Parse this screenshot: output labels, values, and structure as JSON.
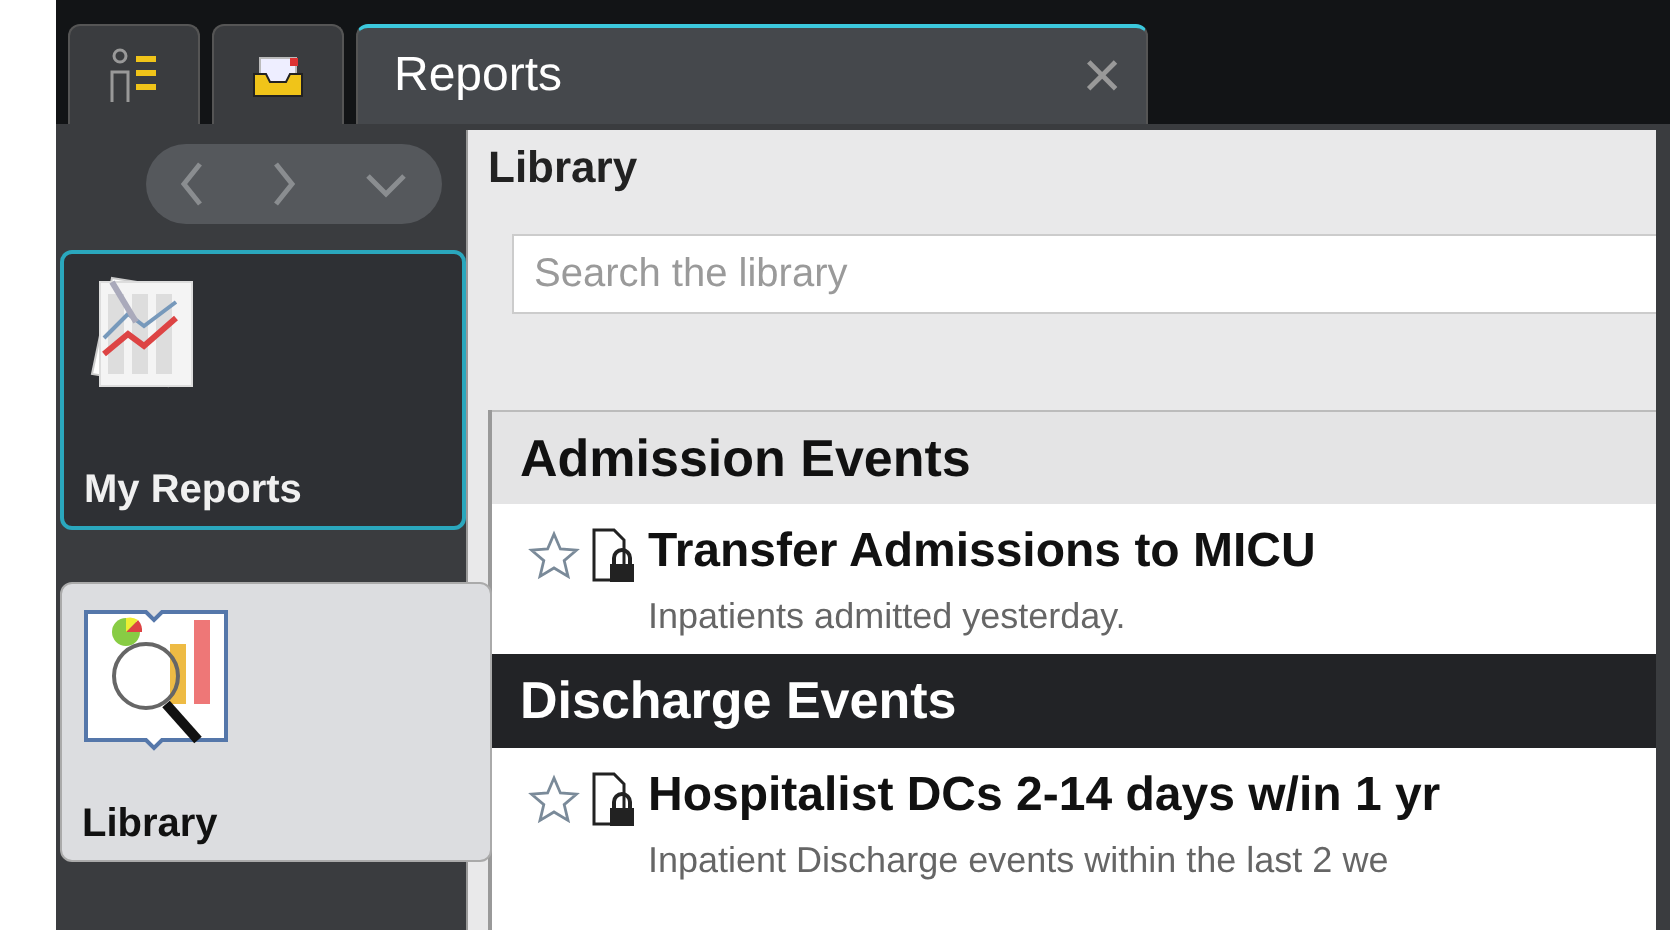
{
  "tabs": [
    {
      "kind": "patient-list",
      "selected": false
    },
    {
      "kind": "inbox",
      "selected": false
    },
    {
      "kind": "text",
      "label": "Reports",
      "selected": true,
      "close": "×"
    }
  ],
  "sidebar": {
    "items": [
      {
        "kind": "reports",
        "label": "My Reports",
        "selected": false
      },
      {
        "kind": "library",
        "label": "Library",
        "selected": true
      }
    ]
  },
  "library": {
    "title": "Library",
    "search": {
      "placeholder": "Search the library"
    },
    "sections": [
      {
        "title": "Admission Events",
        "kind": "light",
        "items": [
          {
            "title": "Transfer Admissions to MICU",
            "description": "Inpatients admitted yesterday.",
            "favorite": false
          }
        ]
      },
      {
        "title": "Discharge Events",
        "kind": "dark",
        "items": [
          {
            "title": "Hospitalist DCs 2-14 days w/in 1 yr",
            "description": "Inpatient Discharge events within the last 2 we",
            "favorite": false
          }
        ]
      }
    ]
  }
}
